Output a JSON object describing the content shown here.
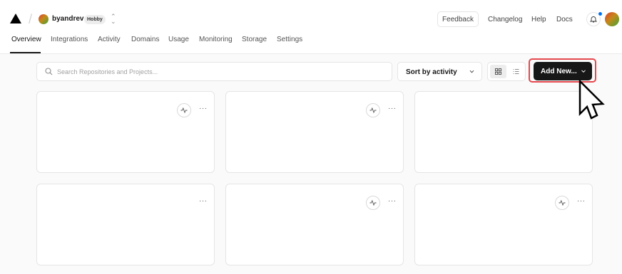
{
  "header": {
    "team": {
      "name": "byandrev",
      "plan": "Hobby"
    },
    "links": {
      "feedback": "Feedback",
      "changelog": "Changelog",
      "help": "Help",
      "docs": "Docs"
    },
    "icons": {
      "logo": "triangle-logo",
      "switcher": "chevron-up-down-icon",
      "notifications": "bell-icon",
      "avatar": "user-avatar"
    }
  },
  "tabs": [
    {
      "label": "Overview",
      "active": true
    },
    {
      "label": "Integrations",
      "active": false
    },
    {
      "label": "Activity",
      "active": false
    },
    {
      "label": "Domains",
      "active": false
    },
    {
      "label": "Usage",
      "active": false
    },
    {
      "label": "Monitoring",
      "active": false
    },
    {
      "label": "Storage",
      "active": false
    },
    {
      "label": "Settings",
      "active": false
    }
  ],
  "toolbar": {
    "search_placeholder": "Search Repositories and Projects...",
    "sort_label": "Sort by activity",
    "view_modes": [
      "grid",
      "list"
    ],
    "selected_view": "grid",
    "add_new_label": "Add New..."
  },
  "cards": [
    {
      "activity_icon": true
    },
    {
      "activity_icon": true
    },
    {
      "activity_icon": false
    },
    {
      "activity_icon": false
    },
    {
      "activity_icon": true
    },
    {
      "activity_icon": true
    }
  ],
  "colors": {
    "primary_button": "#171717",
    "highlight": "#e5484d",
    "notification_dot": "#0070f3",
    "page_background": "#fafafa"
  }
}
